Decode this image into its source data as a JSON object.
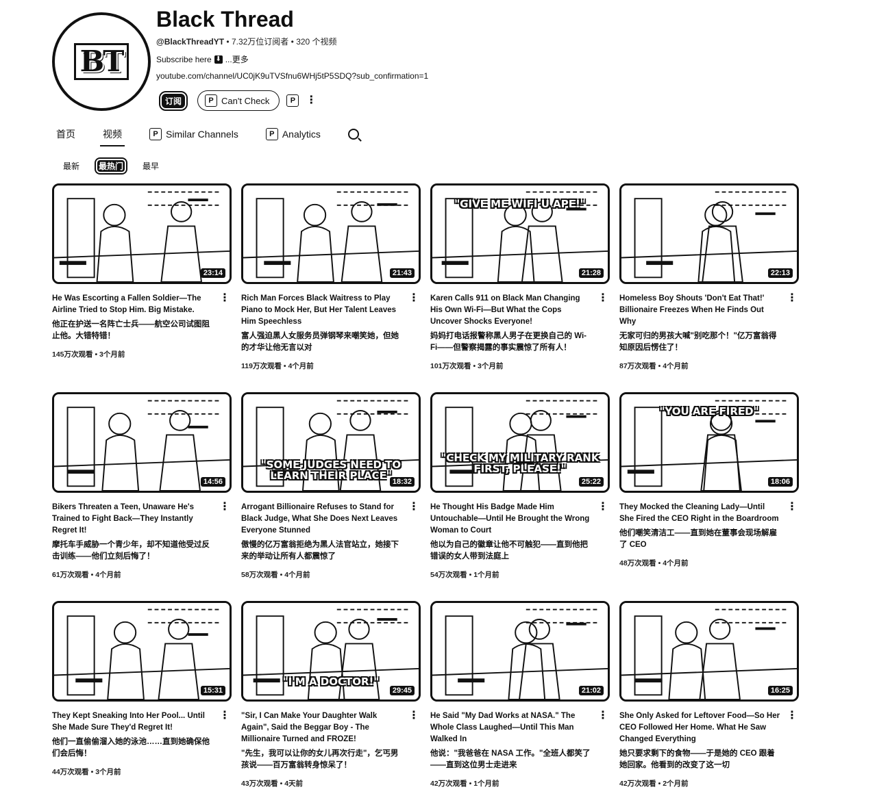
{
  "channel": {
    "avatar_text": "BT",
    "name": "Black Thread",
    "handle": "@BlackThreadYT",
    "subscribers": "7.32万位订阅者",
    "video_count": "320 个视频",
    "description": "Subscribe here",
    "more": "...更多",
    "url": "youtube.com/channel/UC0jK9uTVSfnu6WHj5tP5SDQ?sub_confirmation=1",
    "separator": " • "
  },
  "actions": {
    "subscribe": "订阅",
    "cant_check": "Can't Check"
  },
  "tabs": [
    {
      "label": "首页"
    },
    {
      "label": "视频"
    },
    {
      "label": "Similar Channels"
    },
    {
      "label": "Analytics"
    }
  ],
  "filters": [
    "最新",
    "最热门",
    "最早"
  ],
  "videos": [
    {
      "title_en": "He Was Escorting a Fallen Soldier—The Airline Tried to Stop Him. Big Mistake.",
      "title_zh": "他正在护送一名阵亡士兵——航空公司试图阻止他。大错特错！",
      "views": "145万次观看",
      "age": "3个月前",
      "duration": "23:14",
      "overlay": ""
    },
    {
      "title_en": "Rich Man Forces Black Waitress to Play Piano to Mock Her, But Her Talent Leaves Him Speechless",
      "title_zh": "富人强迫黑人女服务员弹钢琴来嘲笑她，但她的才华让他无言以对",
      "views": "119万次观看",
      "age": "4个月前",
      "duration": "21:43",
      "overlay": ""
    },
    {
      "title_en": "Karen Calls 911 on Black Man Changing His Own Wi-Fi—But What the Cops Uncover Shocks Everyone!",
      "title_zh": "妈妈打电话报警称黑人男子在更换自己的 Wi-Fi——但警察揭露的事实震惊了所有人！",
      "views": "101万次观看",
      "age": "3个月前",
      "duration": "21:28",
      "overlay": "\"GIVE ME WIFI U APE!\""
    },
    {
      "title_en": "Homeless Boy Shouts 'Don't Eat That!' Billionaire Freezes When He Finds Out Why",
      "title_zh": "无家可归的男孩大喊\"别吃那个！\"亿万富翁得知原因后愣住了！",
      "views": "87万次观看",
      "age": "4个月前",
      "duration": "22:13",
      "overlay": ""
    },
    {
      "title_en": "Bikers Threaten a Teen, Unaware He's Trained to Fight Back—They Instantly Regret It!",
      "title_zh": "摩托车手威胁一个青少年，却不知道他受过反击训练——他们立刻后悔了！",
      "views": "61万次观看",
      "age": "4个月前",
      "duration": "14:56",
      "overlay": ""
    },
    {
      "title_en": "Arrogant Billionaire Refuses to Stand for Black Judge, What She Does Next Leaves Everyone Stunned",
      "title_zh": "傲慢的亿万富翁拒绝为黑人法官站立，她接下来的举动让所有人都震惊了",
      "views": "58万次观看",
      "age": "4个月前",
      "duration": "18:32",
      "overlay": "\"SOME JUDGES NEED TO LEARN THEIR PLACE\""
    },
    {
      "title_en": "He Thought His Badge Made Him Untouchable—Until He Brought the Wrong Woman to Court",
      "title_zh": "他以为自己的徽章让他不可触犯——直到他把错误的女人带到法庭上",
      "views": "54万次观看",
      "age": "1个月前",
      "duration": "25:22",
      "overlay": "\"CHECK MY MILITARY RANK FIRST, PLEASE!\""
    },
    {
      "title_en": "They Mocked the Cleaning Lady—Until She Fired the CEO Right in the Boardroom",
      "title_zh": "他们嘲笑清洁工——直到她在董事会现场解雇了 CEO",
      "views": "48万次观看",
      "age": "4个月前",
      "duration": "18:06",
      "overlay": "\"YOU ARE FIRED\""
    },
    {
      "title_en": "They Kept Sneaking Into Her Pool... Until She Made Sure They'd Regret It!",
      "title_zh": "他们一直偷偷溜入她的泳池……直到她确保他们会后悔！",
      "views": "44万次观看",
      "age": "3个月前",
      "duration": "15:31",
      "overlay": ""
    },
    {
      "title_en": "\"Sir, I Can Make Your Daughter Walk Again\", Said the Beggar Boy - The Millionaire Turned and FROZE!",
      "title_zh": "\"先生，我可以让你的女儿再次行走\"，乞丐男孩说——百万富翁转身惊呆了！",
      "views": "43万次观看",
      "age": "4天前",
      "duration": "29:45",
      "overlay": "\"I'M A DOCTOR!\""
    },
    {
      "title_en": "He Said \"My Dad Works at NASA.\" The Whole Class Laughed—Until This Man Walked In",
      "title_zh": "他说：\"我爸爸在 NASA 工作。\"全班人都笑了——直到这位男士走进来",
      "views": "42万次观看",
      "age": "1个月前",
      "duration": "21:02",
      "overlay": ""
    },
    {
      "title_en": "She Only Asked for Leftover Food—So Her CEO Followed Her Home. What He Saw Changed Everything",
      "title_zh": "她只要求剩下的食物——于是她的 CEO 跟着她回家。他看到的改变了这一切",
      "views": "42万次观看",
      "age": "2个月前",
      "duration": "16:25",
      "overlay": ""
    }
  ]
}
